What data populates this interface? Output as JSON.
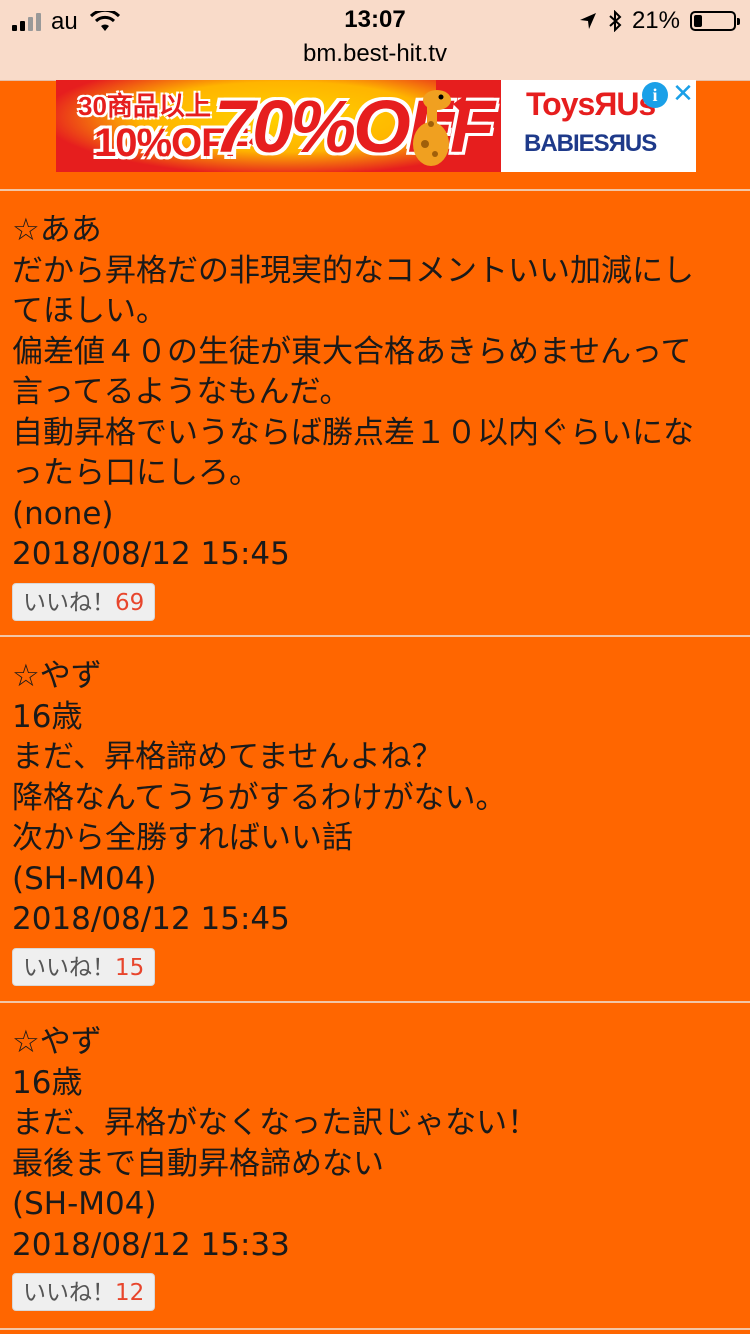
{
  "status_bar": {
    "carrier": "au",
    "time": "13:07",
    "battery_percent": "21%",
    "battery_level": 0.21
  },
  "browser": {
    "url": "bm.best-hit.tv"
  },
  "ad": {
    "line1": "30商品以上",
    "line2": "10%OFF〜",
    "line3": "70%OFF",
    "logo1": "ToysЯUs",
    "logo2": "BABIESЯUS",
    "info": "i",
    "close": "✕"
  },
  "comments": [
    {
      "name": "☆ああ",
      "lines": [
        "だから昇格だの非現実的なコメントいい加減にし",
        "てほしい。",
        "偏差値４０の生徒が東大合格あきらめませんって",
        "言ってるようなもんだ。",
        "自動昇格でいうならば勝点差１０以内ぐらいにな",
        "ったら口にしろ。"
      ],
      "device": "(none)",
      "datetime": "2018/08/12 15:45",
      "like_label": "いいね！",
      "like_count": "69"
    },
    {
      "name": "☆やず",
      "lines": [
        "16歳",
        "まだ、昇格諦めてませんよね？",
        "降格なんてうちがするわけがない。",
        "次から全勝すればいい話"
      ],
      "device": "(SH-M04)",
      "datetime": "2018/08/12 15:45",
      "like_label": "いいね！",
      "like_count": "15"
    },
    {
      "name": "☆やず",
      "lines": [
        "16歳",
        "まだ、昇格がなくなった訳じゃない！",
        "最後まで自動昇格諦めない"
      ],
      "device": "(SH-M04)",
      "datetime": "2018/08/12 15:33",
      "like_label": "いいね！",
      "like_count": "12"
    }
  ]
}
